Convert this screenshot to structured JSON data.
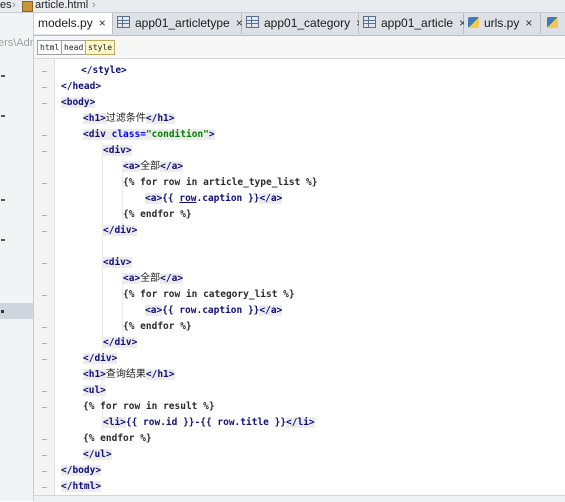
{
  "breadcrumb": {
    "part1": "es",
    "part2": "article.html"
  },
  "sidebar": {
    "path_text": "ers\\Adm"
  },
  "tabs": [
    {
      "label": "models.py",
      "icon": "python-file-icon"
    },
    {
      "label": "app01_articletype",
      "icon": "table-icon"
    },
    {
      "label": "app01_category",
      "icon": "table-icon"
    },
    {
      "label": "app01_article",
      "icon": "table-icon"
    },
    {
      "label": "urls.py",
      "icon": "python-file-icon"
    }
  ],
  "tab_close": "×",
  "tag_path": [
    "html",
    "head",
    "style"
  ],
  "code": {
    "l1": {
      "a": "</style>"
    },
    "l2": {
      "a": "</head>"
    },
    "l3": {
      "a": "<body>"
    },
    "l4": {
      "a": "<h1>",
      "b": "过滤条件",
      "c": "</h1>"
    },
    "l5": {
      "a": "<div ",
      "b": "class=",
      "c": "\"condition\"",
      "d": ">"
    },
    "l6": {
      "a": "<div>"
    },
    "l7": {
      "a": "<a>",
      "b": "全部",
      "c": "</a>"
    },
    "l8": {
      "a": "{% for row in article_type_list %}"
    },
    "l9": {
      "a": "<a>",
      "b": "{{ ",
      "c": "row",
      "d": ".caption }}",
      "e": "</a>"
    },
    "l10": {
      "a": "{% endfor %}"
    },
    "l11": {
      "a": "</div>"
    },
    "l12": {
      "a": "<div>"
    },
    "l13": {
      "a": "<a>",
      "b": "全部",
      "c": "</a>"
    },
    "l14": {
      "a": "{% for row in category_list %}"
    },
    "l15": {
      "a": "<a>",
      "b": "{{ row.caption }}",
      "c": "</a>"
    },
    "l16": {
      "a": "{% endfor %}"
    },
    "l17": {
      "a": "</div>"
    },
    "l18": {
      "a": "</div>"
    },
    "l19": {
      "a": "<h1>",
      "b": "查询结果",
      "c": "</h1>"
    },
    "l20": {
      "a": "<ul>"
    },
    "l21": {
      "a": "{% for row in result %}"
    },
    "l22": {
      "a": "<li>",
      "b": "{{ row.id }}-{{ row.title }}",
      "c": "</li>"
    },
    "l23": {
      "a": "{% endfor %}"
    },
    "l24": {
      "a": "</ul>"
    },
    "l25": {
      "a": "</body>"
    },
    "l26": {
      "a": "</html>"
    }
  },
  "colors": {
    "tag": "#10107a",
    "attr_name": "#0000ff",
    "attr_value": "#008000",
    "tag_highlight": "#fdf8c9",
    "active_tab": "#ffffff"
  }
}
